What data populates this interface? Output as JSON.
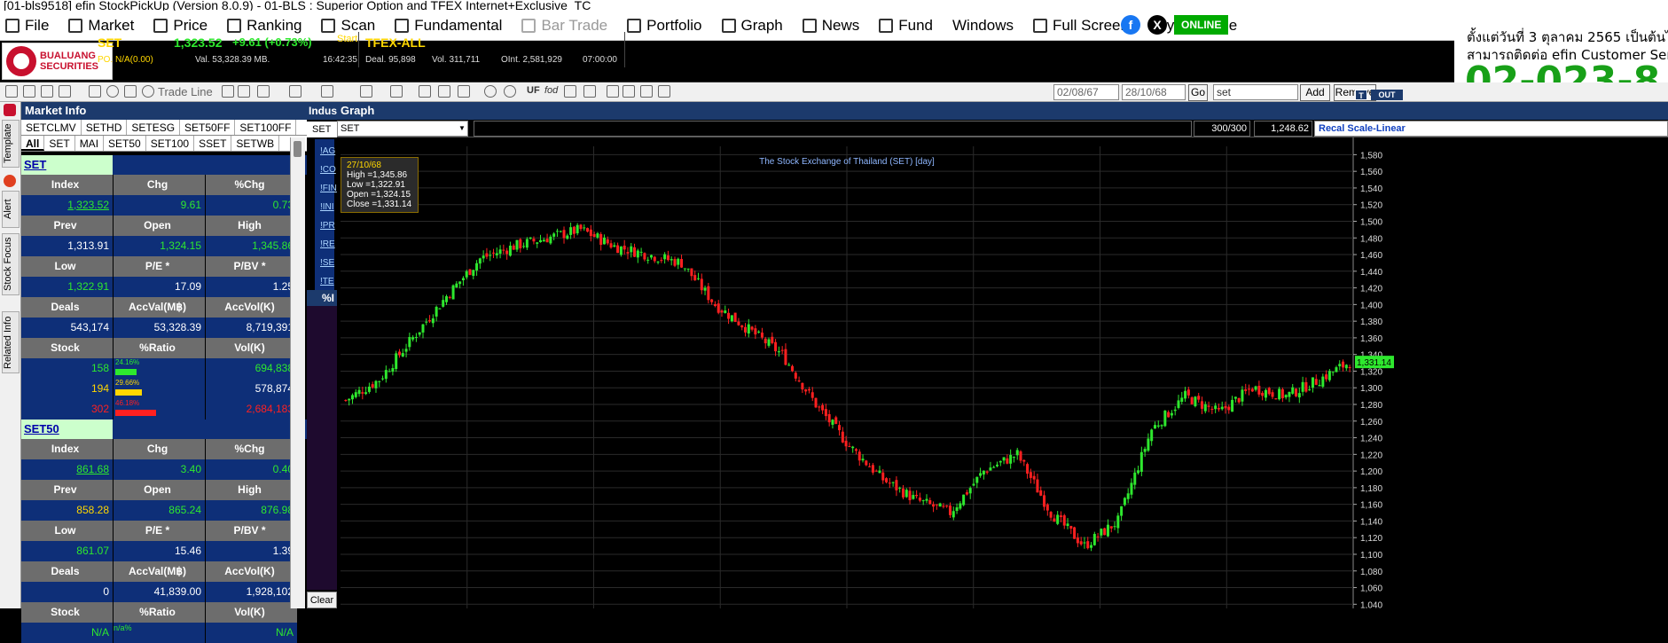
{
  "window": {
    "title": "[01-bls9518] efin StockPickUp (Version 8.0.9) - 01-BLS : Superior Option and TFEX Internet+Exclusive_TC"
  },
  "menu": [
    {
      "label": "File",
      "icon": "file-icon"
    },
    {
      "label": "Market",
      "icon": "market-icon"
    },
    {
      "label": "Price",
      "icon": "price-icon"
    },
    {
      "label": "Ranking",
      "icon": "ranking-icon"
    },
    {
      "label": "Scan",
      "icon": "scan-icon"
    },
    {
      "label": "Fundamental",
      "icon": "fundamental-icon"
    },
    {
      "label": "Bar Trade",
      "icon": "bar-trade-icon",
      "disabled": true
    },
    {
      "label": "Portfolio",
      "icon": "portfolio-icon"
    },
    {
      "label": "Graph",
      "icon": "graph-icon"
    },
    {
      "label": "News",
      "icon": "news-icon"
    },
    {
      "label": "Fund",
      "icon": "fund-icon"
    },
    {
      "label": "Windows",
      "icon": ""
    },
    {
      "label": "Full Screen",
      "icon": "fullscreen-icon"
    },
    {
      "label": "Buy Package",
      "icon": ""
    }
  ],
  "status": {
    "online": "ONLINE"
  },
  "ad": {
    "line1": "ตั้งแต่วันที่ 3 ตุลาคม 2565 เป็นต้นไป",
    "line2": "สามารถติดต่อ efin Customer Service",
    "line3": "02-023-8"
  },
  "logo": {
    "line1": "BUALUANG",
    "line2": "SECURITIES"
  },
  "ticker": {
    "symbol": "SET",
    "price": "1,323.52",
    "change": "+9.61 (+0.73%)",
    "start_label": "Start",
    "po": "PO. N/A(0.00)",
    "val": "Val. 53,328.39 MB.",
    "time": "16:42:35",
    "tfex": "TFEX-ALL",
    "deal": "Deal. 95,898",
    "vol": "Vol. 311,711",
    "oint": "OInt. 2,581,929",
    "tfex_time": "07:00:00"
  },
  "toolbar": {
    "trade_line": "Trade Line",
    "uf": "UF",
    "fod": "fod",
    "date_from": "02/08/67",
    "date_to": "28/10/68",
    "go": "Go",
    "symbol_input": "set",
    "add": "Add",
    "remove": "Remove"
  },
  "left_tabs": [
    "Template",
    "Alert",
    "Stock Focus",
    "Related Info"
  ],
  "market_info": {
    "title": "Market Info",
    "tabs1": [
      "SETCLMV",
      "SETHD",
      "SETESG",
      "SET50FF",
      "SET100FF"
    ],
    "tabs2": [
      "All",
      "SET",
      "MAI",
      "SET50",
      "SET100",
      "SSET",
      "SETWB"
    ],
    "headers": {
      "index": "Index",
      "chg": "Chg",
      "pchg": "%Chg",
      "prev": "Prev",
      "open": "Open",
      "high": "High",
      "low": "Low",
      "pe": "P/E *",
      "pbv": "P/BV *",
      "deals": "Deals",
      "accval": "AccVal(M฿)",
      "accvol": "AccVol(K)",
      "stock": "Stock",
      "ratio": "%Ratio",
      "volk": "Vol(K)"
    },
    "set": {
      "name": "SET",
      "index": "1,323.52",
      "chg": "9.61",
      "pchg": "0.73",
      "prev": "1,313.91",
      "open": "1,324.15",
      "high": "1,345.86",
      "low": "1,322.91",
      "pe": "17.09",
      "pbv": "1.25",
      "deals": "543,174",
      "accval": "53,328.39",
      "accvol": "8,719,391",
      "up": {
        "count": "158",
        "ratio": "24.16%",
        "ratio_value": 24.16,
        "vol": "694,838"
      },
      "unch": {
        "count": "194",
        "ratio": "29.66%",
        "ratio_value": 29.66,
        "vol": "578,874"
      },
      "down": {
        "count": "302",
        "ratio": "46.18%",
        "ratio_value": 46.18,
        "vol": "2,684,183"
      }
    },
    "set50": {
      "name": "SET50",
      "index": "861.68",
      "chg": "3.40",
      "pchg": "0.40",
      "prev": "858.28",
      "open": "865.24",
      "high": "876.98",
      "low": "861.07",
      "pe": "15.46",
      "pbv": "1.39",
      "deals": "0",
      "accval": "41,839.00",
      "accvol": "1,928,102",
      "stock": "N/A",
      "ratio": "n/a%",
      "vol": "N/A"
    }
  },
  "industry": {
    "title": "Indus",
    "tab": "SET",
    "items": [
      "!AG",
      "!CO",
      "!FIN",
      "!INI",
      "!PR",
      "!RE",
      "!SE",
      "!TE"
    ],
    "pct": "%I",
    "clear": "Clear"
  },
  "graph": {
    "title": "Graph",
    "symbol": "SET",
    "count": "300/300",
    "last": "1,248.62",
    "recal": "Recal Scale-Linear",
    "chart_title": "The Stock Exchange of Thailand (SET) [day]",
    "tooltip": {
      "date": "27/10/68",
      "high": "High =1,345.86",
      "low": "Low  =1,322.91",
      "open": "Open  =1,324.15",
      "close": "Close =1,331.14"
    },
    "last_label": "1,331.14",
    "colors": {
      "up": "#2ee82e",
      "down": "#ff2020",
      "grid": "#2a2a2a"
    }
  },
  "chart_data": {
    "type": "line",
    "title": "The Stock Exchange of Thailand (SET) [day]",
    "y_ticks": [
      1040,
      1060,
      1080,
      1100,
      1120,
      1140,
      1160,
      1180,
      1200,
      1220,
      1240,
      1260,
      1280,
      1300,
      1320,
      1340,
      1360,
      1380,
      1400,
      1420,
      1440,
      1460,
      1480,
      1500,
      1520,
      1540,
      1560,
      1580
    ],
    "ylim": [
      1035,
      1590
    ],
    "x": [
      0,
      10,
      20,
      30,
      40,
      50,
      60,
      70,
      80,
      90,
      100,
      110,
      120,
      130,
      140,
      150,
      160,
      170,
      180,
      190,
      200,
      210,
      220,
      230,
      240,
      250,
      260,
      270,
      280,
      290,
      299
    ],
    "series": [
      {
        "values": [
          1285,
          1310,
          1360,
          1410,
          1455,
          1470,
          1480,
          1490,
          1470,
          1460,
          1450,
          1400,
          1370,
          1340,
          1280,
          1230,
          1190,
          1165,
          1150,
          1200,
          1220,
          1150,
          1110,
          1140,
          1250,
          1290,
          1270,
          1300,
          1290,
          1310,
          1331
        ]
      }
    ]
  }
}
